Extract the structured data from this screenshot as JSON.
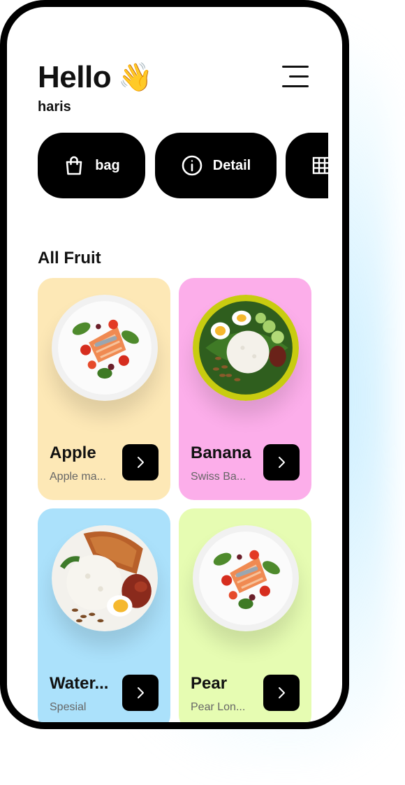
{
  "header": {
    "greeting": "Hello",
    "greeting_icon": "waving-hand-icon",
    "username": "haris",
    "menu_icon": "hamburger-menu-icon"
  },
  "actions": [
    {
      "label": "bag",
      "icon": "shopping-bag-icon"
    },
    {
      "label": "Detail",
      "icon": "info-circle-icon"
    },
    {
      "label": "",
      "icon": "grid-icon"
    }
  ],
  "section_title": "All Fruit",
  "fruits": [
    {
      "name": "Apple",
      "subtitle": "Apple ma...",
      "bg": "#fde8b6",
      "image": "salmon-salad-plate"
    },
    {
      "name": "Banana",
      "subtitle": "Swiss Ba...",
      "bg": "#fcaeea",
      "image": "nasi-lemak-leaf-plate"
    },
    {
      "name": "Water...",
      "subtitle": "Spesial",
      "bg": "#abe1fb",
      "image": "rice-chicken-egg-plate"
    },
    {
      "name": "Pear",
      "subtitle": "Pear Lon...",
      "bg": "#e6fcb2",
      "image": "salmon-salad-plate"
    }
  ],
  "colors": {
    "button_bg": "#000000",
    "text_primary": "#111111",
    "text_secondary": "#666666"
  }
}
